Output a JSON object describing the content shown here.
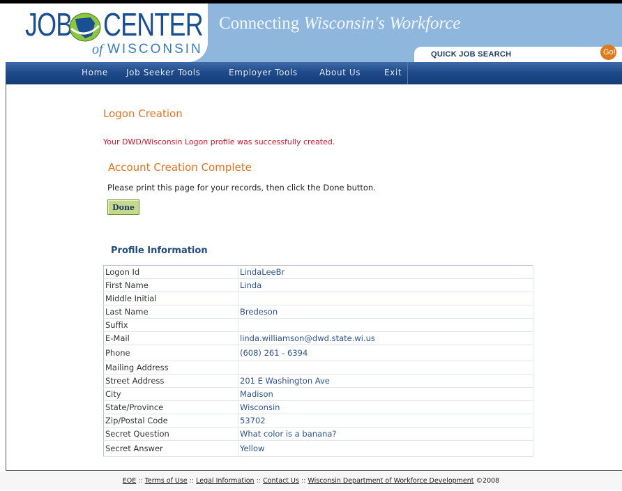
{
  "header": {
    "logo_job": "JOB",
    "logo_center": "CENTER",
    "logo_of": "of",
    "logo_wisconsin": "WISCONSIN",
    "tagline_connecting": "Connecting",
    "tagline_wisconsins": "Wisconsin's",
    "tagline_workforce": "Workforce",
    "quick_job_search": "QUICK JOB SEARCH",
    "go": "Go!"
  },
  "nav": {
    "items": [
      {
        "label": "Home"
      },
      {
        "label": "Job Seeker Tools"
      },
      {
        "label": "Employer Tools"
      },
      {
        "label": "About Us"
      },
      {
        "label": "Exit"
      }
    ]
  },
  "main": {
    "logon_heading": "Logon Creation",
    "success_message": "Your DWD/Wisconsin Logon profile was successfully created.",
    "account_heading": "Account Creation Complete",
    "print_message": "Please print this page for your records, then click the Done button.",
    "done_label": "Done",
    "profile_heading": "Profile Information"
  },
  "profile": {
    "rows": [
      {
        "label": "Logon Id",
        "value": "LindaLeeBr"
      },
      {
        "label": "First Name",
        "value": "Linda"
      },
      {
        "label": "Middle Initial",
        "value": ""
      },
      {
        "label": "Last Name",
        "value": "Bredeson"
      },
      {
        "label": "Suffix",
        "value": ""
      },
      {
        "label": "E-Mail",
        "value": "linda.williamson@dwd.state.wi.us"
      },
      {
        "label": "Phone",
        "value": "(608) 261 - 6394"
      },
      {
        "label": "Mailing Address",
        "value": ""
      },
      {
        "label": "Street Address",
        "value": "201 E Washington Ave"
      },
      {
        "label": "City",
        "value": "Madison"
      },
      {
        "label": "State/Province",
        "value": "Wisconsin"
      },
      {
        "label": "Zip/Postal Code",
        "value": "53702"
      },
      {
        "label": "Secret Question",
        "value": "What color is a banana?"
      },
      {
        "label": "Secret Answer",
        "value": "Yellow"
      }
    ]
  },
  "footer": {
    "eoe": "EOE",
    "terms": "Terms of Use",
    "legal": "Legal Information",
    "contact": "Contact Us",
    "dwd": "Wisconsin Department of Workforce Development",
    "separator": "::",
    "copyright": "©2008"
  },
  "colors": {
    "header_blue": "#8fb7dd",
    "nav_blue": "#1f4b8a",
    "heading_orange": "#e8731c",
    "success_red": "#d8142c",
    "value_blue": "#2b5392",
    "done_green": "#c4d98a"
  }
}
